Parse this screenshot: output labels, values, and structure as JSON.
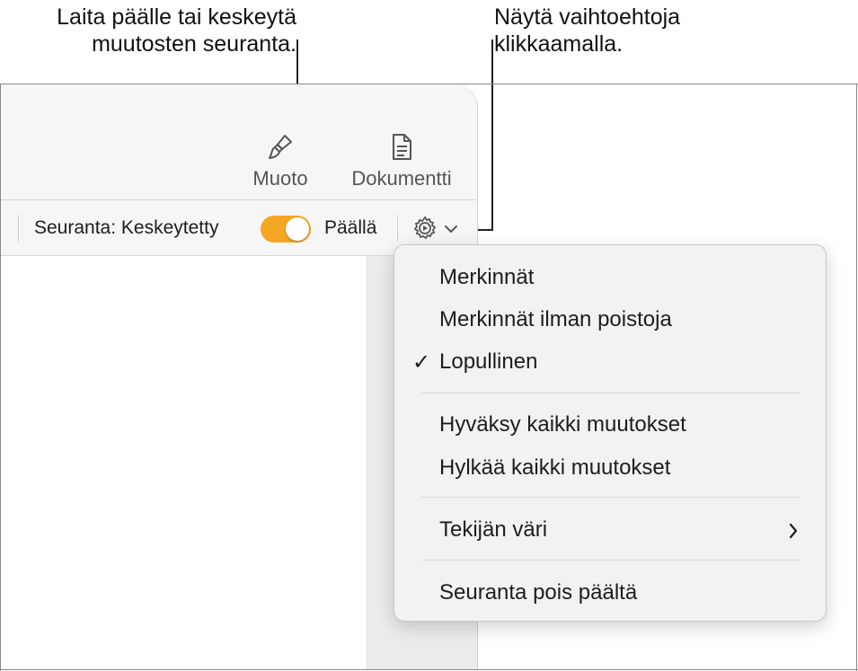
{
  "callouts": {
    "left": "Laita päälle tai keskeytä\nmuutosten seuranta.",
    "right": "Näytä vaihtoehtoja\nklikkaamalla."
  },
  "toolbar": {
    "format_label": "Muoto",
    "format_icon": "paintbrush-icon",
    "document_label": "Dokumentti",
    "document_icon": "document-icon"
  },
  "tracking_bar": {
    "status_label": "Seuranta: Keskeytetty",
    "toggle_state": "on",
    "toggle_color": "#f5a623",
    "on_label": "Päällä",
    "options_icon": "gear-icon"
  },
  "menu": {
    "items": [
      {
        "label": "Merkinnät",
        "checked": false
      },
      {
        "label": "Merkinnät ilman poistoja",
        "checked": false
      },
      {
        "label": "Lopullinen",
        "checked": true
      },
      {
        "label": "Hyväksy kaikki muutokset",
        "checked": false
      },
      {
        "label": "Hylkää kaikki muutokset",
        "checked": false
      },
      {
        "label": "Tekijän väri",
        "checked": false,
        "submenu": true
      },
      {
        "label": "Seuranta pois päältä",
        "checked": false
      }
    ]
  }
}
